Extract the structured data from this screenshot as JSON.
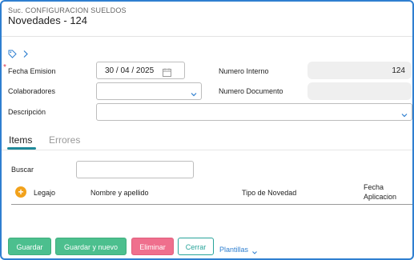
{
  "header": {
    "supertitle": "Suc. CONFIGURACION SUELDOS",
    "title": "Novedades - 124"
  },
  "toolbar": {
    "tag_icon": "tag-icon",
    "chevron": "chevron-right-icon"
  },
  "form": {
    "fecha_label": "Fecha Emision",
    "required_mark": "*",
    "fecha_value": "30 / 04 / 2025",
    "numero_interno_label": "Numero Interno",
    "numero_interno_value": "124",
    "colaboradores_label": "Colaboradores",
    "colaboradores_value": "",
    "numero_documento_label": "Numero Documento",
    "numero_documento_value": "",
    "descripcion_label": "Descripción",
    "descripcion_value": ""
  },
  "tabs": [
    {
      "label": "Items",
      "active": true
    },
    {
      "label": "Errores",
      "active": false
    }
  ],
  "items": {
    "buscar_label": "Buscar",
    "buscar_value": "",
    "columns": [
      "Legajo",
      "Nombre y apellido",
      "Tipo de Novedad",
      "Fecha",
      "Aplicacion"
    ],
    "add_icon": "+"
  },
  "footer": {
    "guardar": "Guardar",
    "guardar_nuevo": "Guardar y nuevo",
    "eliminar": "Eliminar",
    "cerrar": "Cerrar",
    "plantillas": "Plantillas",
    "plantillas_chev": "⌄"
  },
  "colors": {
    "accent": "#2f7fd0",
    "green": "#4cbf8e",
    "pink": "#ef6f8d",
    "teal": "#28a49a",
    "add_orange": "#f2a21c"
  }
}
